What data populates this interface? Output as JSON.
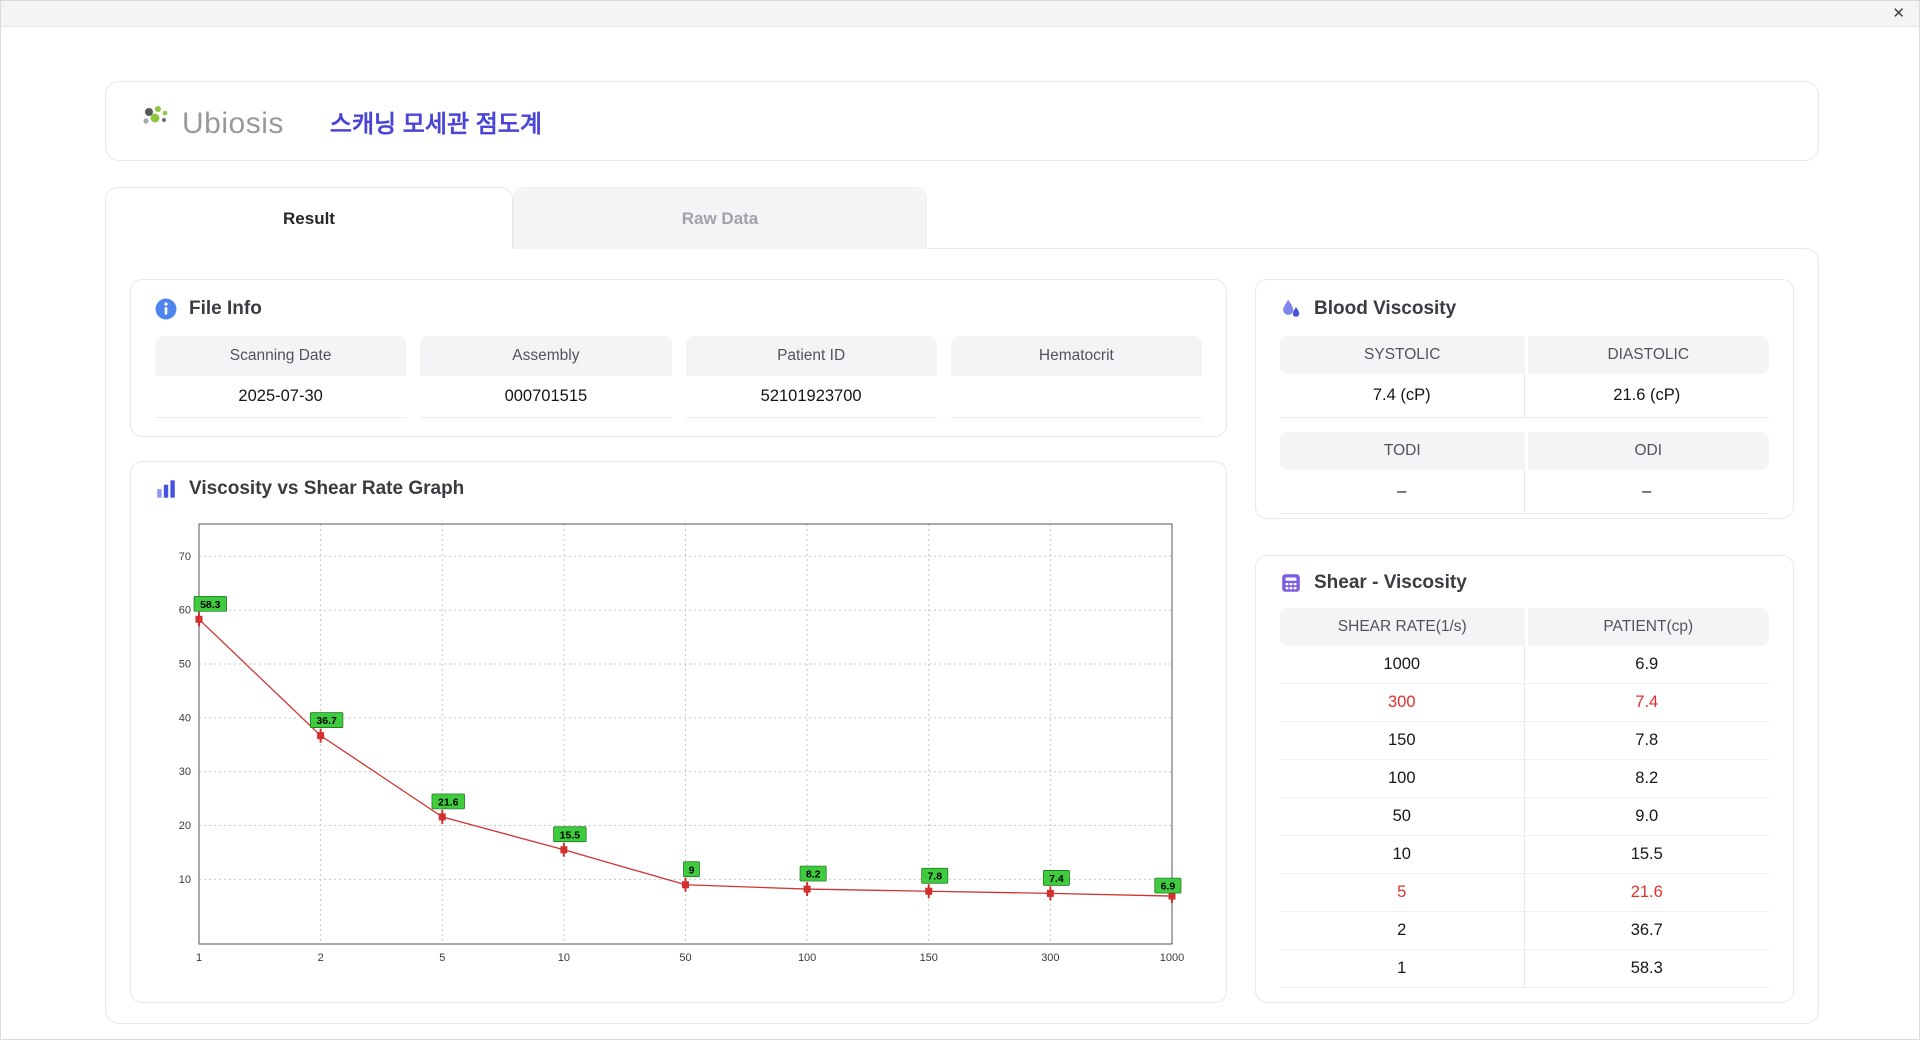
{
  "window": {
    "close": "✕"
  },
  "header": {
    "brand": "Ubiosis",
    "app_title": "스캐닝 모세관 점도계"
  },
  "tabs": [
    {
      "label": "Result",
      "active": true
    },
    {
      "label": "Raw Data",
      "active": false
    }
  ],
  "file_info": {
    "title": "File Info",
    "fields": [
      {
        "label": "Scanning Date",
        "value": "2025-07-30"
      },
      {
        "label": "Assembly",
        "value": "000701515"
      },
      {
        "label": "Patient ID",
        "value": "52101923700"
      },
      {
        "label": "Hematocrit",
        "value": ""
      }
    ]
  },
  "blood_viscosity": {
    "title": "Blood Viscosity",
    "cells": [
      {
        "label": "SYSTOLIC",
        "value": "7.4 (cP)"
      },
      {
        "label": "DIASTOLIC",
        "value": "21.6 (cP)"
      },
      {
        "label": "TODI",
        "value": "–"
      },
      {
        "label": "ODI",
        "value": "–"
      }
    ]
  },
  "graph_section": {
    "title": "Viscosity vs Shear Rate Graph"
  },
  "shear_viscosity": {
    "title": "Shear - Viscosity",
    "columns": [
      "SHEAR RATE(1/s)",
      "PATIENT(cp)"
    ],
    "rows": [
      {
        "shear_rate": "1000",
        "patient": "6.9",
        "highlight": false
      },
      {
        "shear_rate": "300",
        "patient": "7.4",
        "highlight": true
      },
      {
        "shear_rate": "150",
        "patient": "7.8",
        "highlight": false
      },
      {
        "shear_rate": "100",
        "patient": "8.2",
        "highlight": false
      },
      {
        "shear_rate": "50",
        "patient": "9.0",
        "highlight": false
      },
      {
        "shear_rate": "10",
        "patient": "15.5",
        "highlight": false
      },
      {
        "shear_rate": "5",
        "patient": "21.6",
        "highlight": true
      },
      {
        "shear_rate": "2",
        "patient": "36.7",
        "highlight": false
      },
      {
        "shear_rate": "1",
        "patient": "58.3",
        "highlight": false
      }
    ]
  },
  "chart_data": {
    "type": "line",
    "title": "Viscosity vs Shear Rate Graph",
    "x": [
      1,
      2,
      5,
      10,
      50,
      100,
      150,
      300,
      1000
    ],
    "x_tick_labels": [
      "1",
      "2",
      "5",
      "10",
      "50",
      "100",
      "150",
      "300",
      "1000"
    ],
    "values": [
      58.3,
      36.7,
      21.6,
      15.5,
      9.0,
      8.2,
      7.8,
      7.4,
      6.9
    ],
    "point_labels": [
      "58.3",
      "36.7",
      "21.6",
      "15.5",
      "9",
      "8.2",
      "7.8",
      "7.4",
      "6.9"
    ],
    "x_scale": "even-spaced-ticks",
    "xlabel": "",
    "ylabel": "",
    "ylim": [
      0,
      75
    ],
    "y_ticks": [
      10,
      20,
      30,
      40,
      50,
      60,
      70
    ],
    "grid": true,
    "legend": "none",
    "line_color": "#cf3434",
    "marker_color": "#d32f2f",
    "point_label_bg": "#3ecc3e"
  }
}
